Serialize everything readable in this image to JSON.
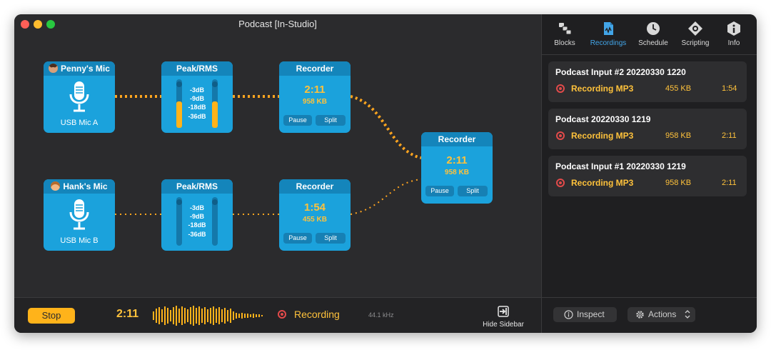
{
  "window": {
    "title": "Podcast [In-Studio]"
  },
  "blocks": {
    "mic_a": {
      "title": "Penny's Mic",
      "label": "USB Mic A"
    },
    "mic_b": {
      "title": "Hank's Mic",
      "label": "USB Mic B"
    },
    "meter_a": {
      "title": "Peak/RMS",
      "db_labels": [
        "-3dB",
        "-9dB",
        "-18dB",
        "-36dB"
      ],
      "level_left": 0.55,
      "level_right": 0.55
    },
    "meter_b": {
      "title": "Peak/RMS",
      "db_labels": [
        "-3dB",
        "-9dB",
        "-18dB",
        "-36dB"
      ],
      "level_left": 0.0,
      "level_right": 0.0
    },
    "recorder_a": {
      "title": "Recorder",
      "time": "2:11",
      "size": "958 KB",
      "pause": "Pause",
      "split": "Split"
    },
    "recorder_b": {
      "title": "Recorder",
      "time": "1:54",
      "size": "455 KB",
      "pause": "Pause",
      "split": "Split"
    },
    "recorder_mix": {
      "title": "Recorder",
      "time": "2:11",
      "size": "958 KB",
      "pause": "Pause",
      "split": "Split"
    }
  },
  "bottombar": {
    "stop_label": "Stop",
    "time": "2:11",
    "status": "Recording",
    "sample_rate": "44.1 kHz",
    "hide_sidebar": "Hide Sidebar"
  },
  "sidebar": {
    "tabs": [
      {
        "label": "Blocks",
        "icon": "blocks-icon"
      },
      {
        "label": "Recordings",
        "icon": "recordings-icon"
      },
      {
        "label": "Schedule",
        "icon": "clock-icon"
      },
      {
        "label": "Scripting",
        "icon": "scripting-icon"
      },
      {
        "label": "Info",
        "icon": "info-icon"
      }
    ],
    "active_tab": "Recordings",
    "recordings": [
      {
        "title": "Podcast Input #2 20220330 1220",
        "format": "Recording MP3",
        "size": "455 KB",
        "duration": "1:54"
      },
      {
        "title": "Podcast 20220330 1219",
        "format": "Recording MP3",
        "size": "958 KB",
        "duration": "2:11"
      },
      {
        "title": "Podcast Input #1 20220330 1219",
        "format": "Recording MP3",
        "size": "958 KB",
        "duration": "2:11"
      }
    ],
    "inspect_label": "Inspect",
    "actions_label": "Actions"
  },
  "colors": {
    "block_blue": "#1ba2dc",
    "accent_orange": "#ffc23b",
    "record_red": "#e24a4a",
    "active_tab_blue": "#42a5e8"
  }
}
